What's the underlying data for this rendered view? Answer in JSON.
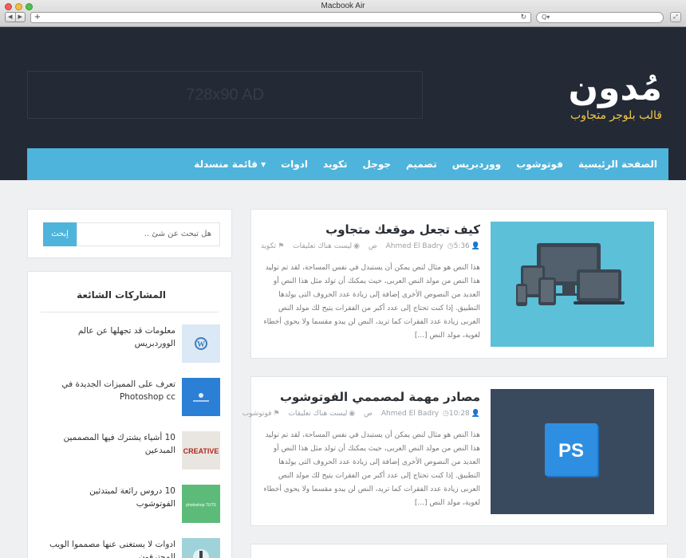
{
  "browser": {
    "window_title": "Macbook Air",
    "back_glyph": "◀",
    "forward_glyph": "▶",
    "new_tab_glyph": "+",
    "reload_glyph": "↻",
    "search_glyph": "Q▾",
    "resize_glyph": "⤢"
  },
  "header": {
    "logo": "مُدون",
    "tagline": "قالب بلوجر متجاوب",
    "ad_text": "728x90 AD"
  },
  "nav": {
    "items": [
      "الصفحة الرئيسية",
      "فوتوشوب",
      "ووردبريس",
      "تصميم",
      "جوجل",
      "تكويد",
      "ادوات",
      "قائمة منسدلة ▾"
    ]
  },
  "posts": [
    {
      "title": "كيف تجعل موقعك متجاوب",
      "author": "Ahmed El Badry",
      "time": "5:36 ص",
      "comments": "ليست هناك تعليقات",
      "category": "تكويد",
      "excerpt": "هذا النص هو مثال لنص يمكن أن يستبدل في نفس المساحة، لقد تم توليد هذا النص من مولد النص العربى، حيث يمكنك أن تولد مثل هذا النص أو العديد من النصوص الأخرى إضافة إلى زيادة عدد الحروف التى يولدها التطبيق. إذا كنت تحتاج إلى عدد أكبر من الفقرات يتيح لك مولد النص العربى زيادة عدد الفقرات كما تريد، النص لن يبدو مقسما ولا يحوي أخطاء لغوية، مولد النص [...]"
    },
    {
      "title": "مصادر مهمة لمصممي الفوتوشوب",
      "author": "Ahmed El Badry",
      "time": "10:28 ص",
      "comments": "ليست هناك تعليقات",
      "category": "فوتوشوب",
      "image_label": "PS",
      "excerpt": "هذا النص هو مثال لنص يمكن أن يستبدل في نفس المساحة، لقد تم توليد هذا النص من مولد النص العربى، حيث يمكنك أن تولد مثل هذا النص أو العديد من النصوص الأخرى إضافة إلى زيادة عدد الحروف التى يولدها التطبيق. إذا كنت تحتاج إلى عدد أكبر من الفقرات يتيح لك مولد النص العربى زيادة عدد الفقرات كما تريد، النص لن يبدو مقسما ولا يحوي أخطاء لغوية، مولد النص [...]"
    }
  ],
  "sidebar": {
    "search": {
      "placeholder": "هل تبحث عن شئ ..",
      "button": "إبحث"
    },
    "popular": {
      "title": "المشاركات الشائعة",
      "items": [
        {
          "text": "معلومات قد تجهلها عن عالم الووردبريس",
          "thumb_color": "#dbe8f5",
          "thumb_icon": "wordpress-icon"
        },
        {
          "text": "تعرف على المميزات الجديدة في Photoshop cc",
          "thumb_color": "#2b7fd4",
          "thumb_icon": "photoshop-icon"
        },
        {
          "text": "10 أشياء يشترك فيها المصممين المبدعين",
          "thumb_color": "#e9e6e1",
          "thumb_label": "CREATIVE"
        },
        {
          "text": "10 دروس رائعة لمبتدئين الفوتوشوب",
          "thumb_color": "#5dbb7a",
          "thumb_label": "photoshop TUTS"
        },
        {
          "text": "ادوات لا يستغنى عنها مصمموا الويب المحترفون",
          "thumb_color": "#9fd3d9",
          "thumb_icon": "tools-icon"
        }
      ]
    }
  },
  "colors": {
    "header_bg": "#232a35",
    "nav_bg": "#4fb4db",
    "tagline": "#f3c94a",
    "accent": "#4fb4db"
  }
}
